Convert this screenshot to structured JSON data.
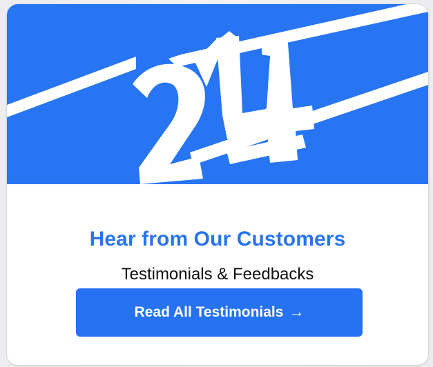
{
  "card": {
    "hero": {
      "logo_text": "24",
      "background": "#2875f3",
      "logo_color": "#ffffff"
    },
    "title": "Hear from Our Customers",
    "subtitle": "Testimonials & Feedbacks",
    "cta": {
      "label": "Read All Testimonials",
      "arrow": "→"
    }
  },
  "colors": {
    "accent": "#2874f0",
    "button": "#2672f3",
    "text": "#111111",
    "card_background": "#ffffff"
  }
}
